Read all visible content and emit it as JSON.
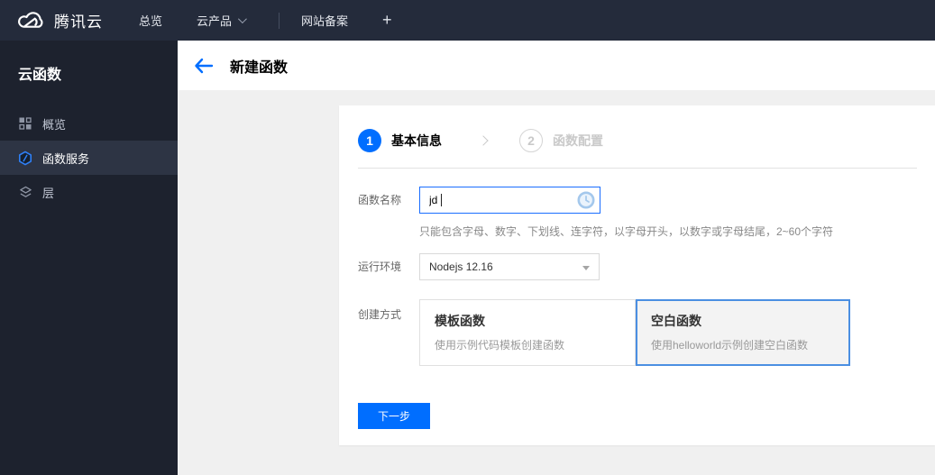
{
  "topbar": {
    "brand": "腾讯云",
    "nav": [
      {
        "label": "总览"
      },
      {
        "label": "云产品",
        "has_caret": true
      },
      {
        "label": "网站备案"
      }
    ],
    "plus_label": "+"
  },
  "sidebar": {
    "title": "云函数",
    "items": [
      {
        "label": "概览",
        "icon": "overview-grid-icon",
        "selected": false
      },
      {
        "label": "函数服务",
        "icon": "function-service-icon",
        "selected": true
      },
      {
        "label": "层",
        "icon": "layers-icon",
        "selected": false
      }
    ]
  },
  "header": {
    "title": "新建函数"
  },
  "wizard": {
    "steps": [
      {
        "number": "1",
        "label": "基本信息",
        "active": true
      },
      {
        "number": "2",
        "label": "函数配置",
        "active": false
      }
    ]
  },
  "form": {
    "name_label": "函数名称",
    "name_value": "jd",
    "name_hint": "只能包含字母、数字、下划线、连字符，以字母开头，以数字或字母结尾，2~60个字符",
    "runtime_label": "运行环境",
    "runtime_value": "Nodejs 12.16",
    "method_label": "创建方式",
    "methods": [
      {
        "title": "模板函数",
        "desc": "使用示例代码模板创建函数",
        "selected": false
      },
      {
        "title": "空白函数",
        "desc": "使用helloworld示例创建空白函数",
        "selected": true
      }
    ],
    "next_button": "下一步"
  },
  "colors": {
    "accent_blue": "#006eff",
    "selected_card_border": "#4b8fe2",
    "topbar_bg": "#242b3b",
    "sidebar_bg": "#1d222e",
    "sidebar_selected_bg": "#2d3444",
    "content_bg": "#f0f0f0"
  }
}
